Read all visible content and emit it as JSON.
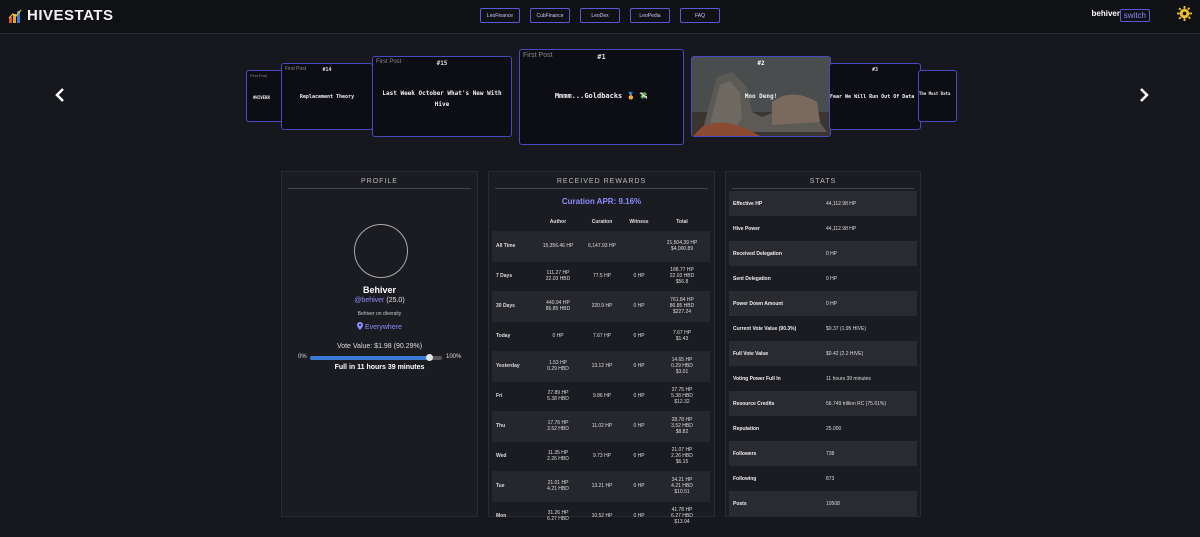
{
  "app": {
    "name": "HIVESTATS",
    "accent": "#8c8cff",
    "logo_icon": "chart-icon"
  },
  "nav": {
    "links": [
      "LeoFinance",
      "CubFinance",
      "LeoDex",
      "LeoPedia",
      "FAQ"
    ]
  },
  "header": {
    "user": "behiver",
    "switch_label": "switch",
    "settings_icon": "gear-icon"
  },
  "carousel": {
    "prev_icon": "chevron-left-icon",
    "next_icon": "chevron-right-icon",
    "cards": [
      {
        "img_alt": "First Post",
        "rank": "",
        "title": "#HIVEBR"
      },
      {
        "img_alt": "First Post",
        "rank": "#14",
        "title": "Replacement Theory"
      },
      {
        "img_alt": "First Post",
        "rank": "#15",
        "title": "Last Week October What's New With Hive"
      },
      {
        "img_alt": "First Post",
        "rank": "#1",
        "title": "Mmmm...Goldbacks 🏅 💸"
      },
      {
        "img_alt": "",
        "rank": "#2",
        "title": "Moo Deng!"
      },
      {
        "img_alt": "",
        "rank": "#3",
        "title": "Fear We Will Run Out Of Data"
      },
      {
        "img_alt": "",
        "rank": "",
        "title": "The Most Data"
      }
    ]
  },
  "profile": {
    "heading": "PROFILE",
    "name": "Behiver",
    "handle": "@behiver",
    "reputation": "(25.0)",
    "description": "Behiver on diversity",
    "location": "Everywhere",
    "location_icon": "map-pin-icon",
    "vote_value": "Vote Value: $1.98 (90.29%)",
    "bar_min": "0%",
    "bar_max": "100%",
    "voting_power": 0.9029,
    "full_in": "Full in 11 hours 39 minutes"
  },
  "rewards": {
    "heading": "RECEIVED REWARDS",
    "curation_apr": "Curation APR: 9.16%",
    "columns": [
      "",
      "Author",
      "Curation",
      "Witness",
      "Total"
    ],
    "rows": [
      {
        "label": "All Time",
        "author": [
          "15,356.46 HP"
        ],
        "curation": "6,147.93 HP",
        "witness": "",
        "total": [
          "21,504.39 HP",
          "$4,000.89"
        ]
      },
      {
        "label": "7 Days",
        "author": [
          "111.27 HP",
          "22.03 HBD"
        ],
        "curation": "77.5 HP",
        "witness": "0 HP",
        "total": [
          "188.77 HP",
          "22.03 HBD",
          "$56.8"
        ]
      },
      {
        "label": "30 Days",
        "author": [
          "440.94 HP",
          "86.85 HBD"
        ],
        "curation": "320.9 HP",
        "witness": "0 HP",
        "total": [
          "761.84 HP",
          "86.85 HBD",
          "$227.24"
        ]
      },
      {
        "label": "Today",
        "author": [
          "0 HP"
        ],
        "curation": "7.67 HP",
        "witness": "0 HP",
        "total": [
          "7.67 HP",
          "$1.43"
        ]
      },
      {
        "label": "Yesterday",
        "author": [
          "1.53 HP",
          "0.29 HBD"
        ],
        "curation": "13.12 HP",
        "witness": "0 HP",
        "total": [
          "14.65 HP",
          "0.29 HBD",
          "$3.01"
        ]
      },
      {
        "label": "Fri",
        "author": [
          "27.89 HP",
          "5.38 HBD"
        ],
        "curation": "9.86 HP",
        "witness": "0 HP",
        "total": [
          "37.75 HP",
          "5.38 HBD",
          "$12.32"
        ]
      },
      {
        "label": "Thu",
        "author": [
          "17.76 HP",
          "3.52 HBD"
        ],
        "curation": "11.02 HP",
        "witness": "0 HP",
        "total": [
          "28.78 HP",
          "3.52 HBD",
          "$8.82"
        ]
      },
      {
        "label": "Wed",
        "author": [
          "11.35 HP",
          "2.26 HBD"
        ],
        "curation": "9.73 HP",
        "witness": "0 HP",
        "total": [
          "21.07 HP",
          "2.26 HBD",
          "$6.15"
        ]
      },
      {
        "label": "Tue",
        "author": [
          "21.01 HP",
          "4.21 HBD"
        ],
        "curation": "13.21 HP",
        "witness": "0 HP",
        "total": [
          "34.21 HP",
          "4.21 HBD",
          "$10.51"
        ]
      },
      {
        "label": "Mon",
        "author": [
          "31.26 HP",
          "6.27 HBD"
        ],
        "curation": "10.52 HP",
        "witness": "0 HP",
        "total": [
          "41.78 HP",
          "6.27 HBD",
          "$13.94"
        ]
      }
    ]
  },
  "stats": {
    "heading": "STATS",
    "rows": [
      {
        "k": "Effective HP",
        "v": "44,112.98 HP"
      },
      {
        "k": "Hive Power",
        "v": "44,112.98 HP"
      },
      {
        "k": "Received Delegation",
        "v": "0 HP"
      },
      {
        "k": "Sent Delegation",
        "v": "0 HP"
      },
      {
        "k": "Power Down Amount",
        "v": "0 HP"
      },
      {
        "k": "Current Vote Value (90.3%)",
        "v": "$0.37 (1.95 HIVE)"
      },
      {
        "k": "Full Vote Value",
        "v": "$0.42 (2.2 HIVE)"
      },
      {
        "k": "Voting Power Full In",
        "v": "11 hours 39 minutes"
      },
      {
        "k": "Resource Credits",
        "v": "56.749 trillion RC (75.61%)"
      },
      {
        "k": "Reputation",
        "v": "25.000"
      },
      {
        "k": "Followers",
        "v": "738"
      },
      {
        "k": "Following",
        "v": "873"
      },
      {
        "k": "Posts",
        "v": "10508"
      }
    ]
  }
}
